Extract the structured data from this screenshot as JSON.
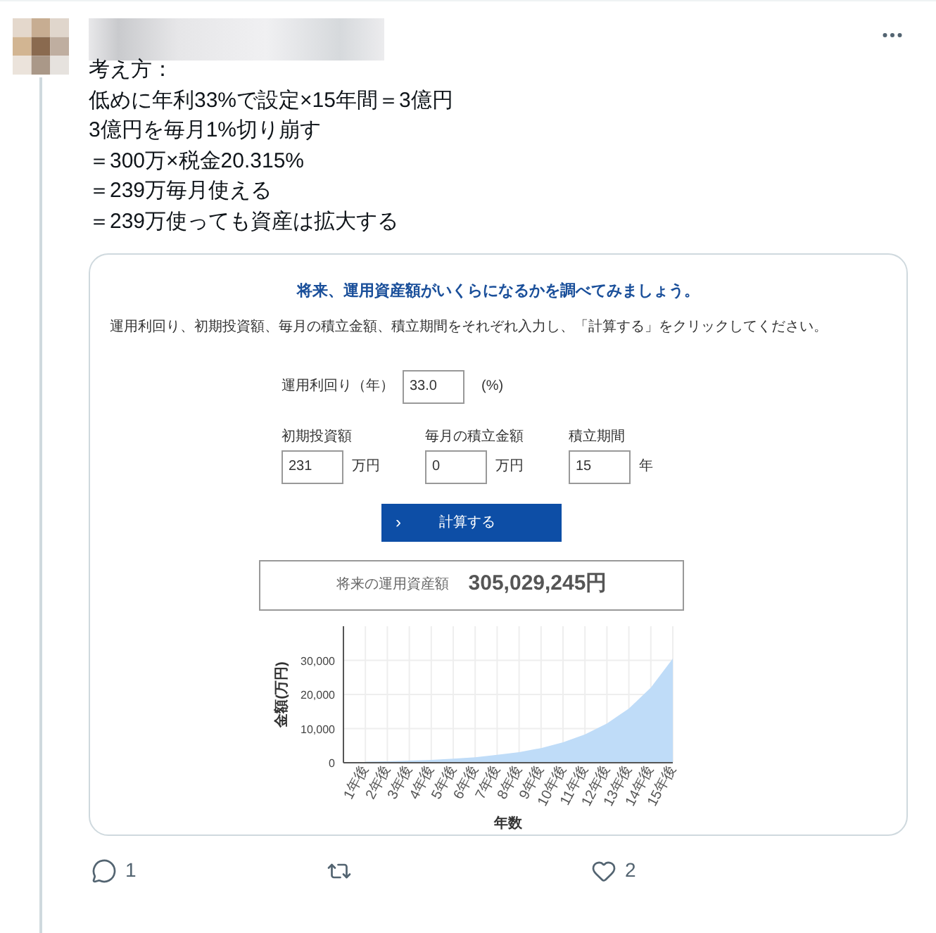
{
  "post": {
    "lines": [
      "考え方：",
      "低めに年利33%で設定×15年間＝3億円",
      "3億円を毎月1%切り崩す",
      "＝300万×税金20.315%",
      "＝239万毎月使える",
      "＝239万使っても資産は拡大する"
    ]
  },
  "screenshot": {
    "heading": "将来、運用資産額がいくらになるかを調べてみましょう。",
    "instruction": "運用利回り、初期投資額、毎月の積立金額、積立期間をそれぞれ入力し、「計算する」をクリックしてください。",
    "rate": {
      "label": "運用利回り（年）",
      "value": "33.0",
      "unit": "(%)"
    },
    "fields": [
      {
        "label": "初期投資額",
        "value": "231",
        "unit": "万円"
      },
      {
        "label": "毎月の積立金額",
        "value": "0",
        "unit": "万円"
      },
      {
        "label": "積立期間",
        "value": "15",
        "unit": "年"
      }
    ],
    "button": {
      "icon": "›",
      "label": "計算する"
    },
    "result": {
      "label": "将来の運用資産額",
      "value": "305,029,245円"
    },
    "chart_data": {
      "type": "area",
      "xlabel": "年数",
      "ylabel": "金額(万円)",
      "categories": [
        "1年後",
        "2年後",
        "3年後",
        "4年後",
        "5年後",
        "6年後",
        "7年後",
        "8年後",
        "9年後",
        "10年後",
        "11年後",
        "12年後",
        "13年後",
        "14年後",
        "15年後"
      ],
      "ylim": [
        0,
        40000
      ],
      "yticks": [
        {
          "value": 0,
          "label": "0"
        },
        {
          "value": 10000,
          "label": "10,000"
        },
        {
          "value": 20000,
          "label": "20,000"
        },
        {
          "value": 30000,
          "label": "30,000"
        }
      ],
      "grid": true,
      "series": [
        {
          "color": "#bfdcf8",
          "values": [
            300,
            400,
            600,
            800,
            1200,
            1600,
            2300,
            3100,
            4300,
            6000,
            8300,
            11500,
            15900,
            22000,
            30500
          ]
        }
      ]
    }
  },
  "actions": [
    {
      "kind": "reply",
      "count": "1"
    },
    {
      "kind": "repost"
    },
    {
      "kind": "like",
      "count": "2"
    }
  ]
}
